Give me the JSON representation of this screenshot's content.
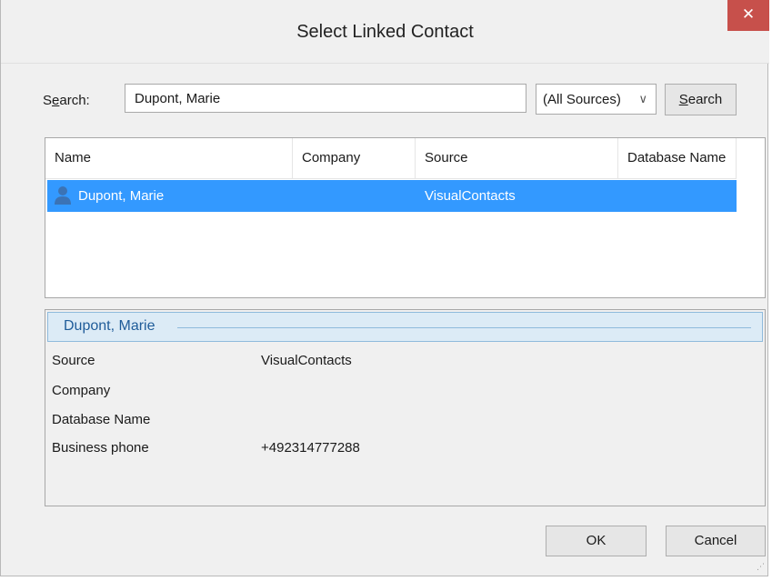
{
  "dialog": {
    "title": "Select Linked Contact",
    "close_symbol": "✕"
  },
  "search": {
    "label_pre": "S",
    "label_mnemonic": "e",
    "label_post": "arch:",
    "query": "Dupont, Marie",
    "source_selected": "(All Sources)",
    "button_mnemonic": "S",
    "button_rest": "earch"
  },
  "results": {
    "columns": [
      "Name",
      "Company",
      "Source",
      "Database Name"
    ],
    "rows": [
      {
        "name": "Dupont, Marie",
        "company": "",
        "source": "VisualContacts",
        "database": "",
        "icon": "person-icon",
        "selected": true
      }
    ]
  },
  "details": {
    "header": "Dupont, Marie",
    "fields": [
      {
        "label": "Source",
        "value": "VisualContacts"
      },
      {
        "label": "Company",
        "value": ""
      },
      {
        "label": "Database Name",
        "value": ""
      },
      {
        "label": "Business phone",
        "value": "+492314777288"
      }
    ]
  },
  "buttons": {
    "ok": "OK",
    "cancel": "Cancel"
  },
  "colors": {
    "selection": "#3399ff",
    "close": "#c7504b",
    "details_header": "#dcebf6",
    "details_text": "#1f5c99"
  }
}
